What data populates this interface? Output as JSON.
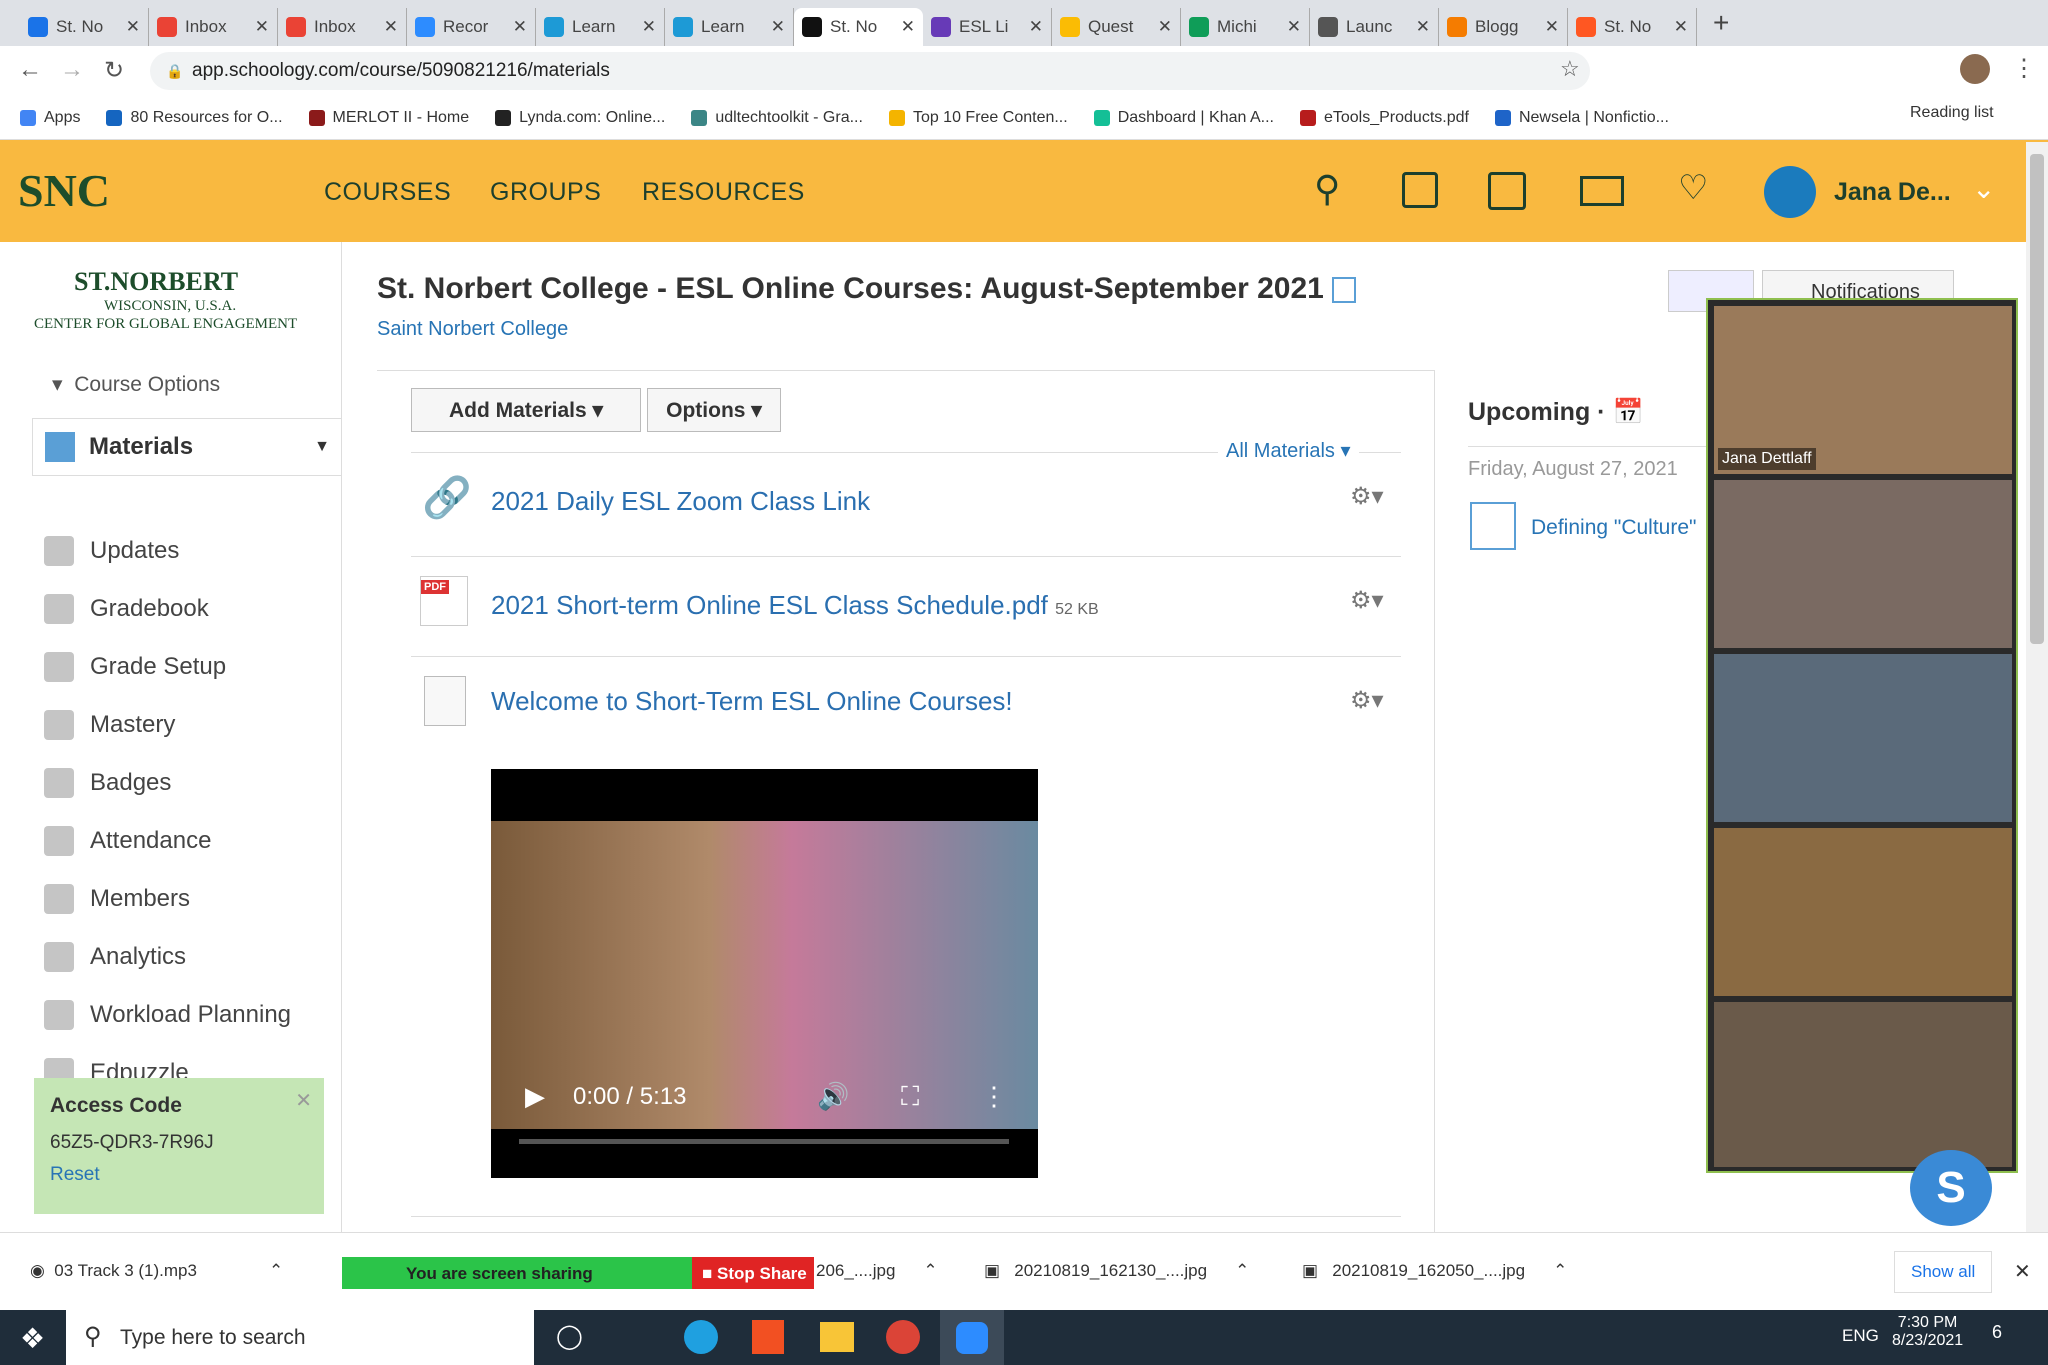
{
  "browser": {
    "tabs": [
      {
        "label": "St. No",
        "color": "#1a73e8"
      },
      {
        "label": "Inbox",
        "color": "#ea4335"
      },
      {
        "label": "Inbox",
        "color": "#ea4335"
      },
      {
        "label": "Recor",
        "color": "#2d8cff"
      },
      {
        "label": "Learn",
        "color": "#1d9ad6"
      },
      {
        "label": "Learn",
        "color": "#1d9ad6"
      },
      {
        "label": "St. No",
        "color": "#111111"
      },
      {
        "label": "ESL Li",
        "color": "#673ab7"
      },
      {
        "label": "Quest",
        "color": "#fbbc04"
      },
      {
        "label": "Michi",
        "color": "#0f9d58"
      },
      {
        "label": "Launc",
        "color": "#555555"
      },
      {
        "label": "Blogg",
        "color": "#f57c00"
      },
      {
        "label": "St. No",
        "color": "#ff5722"
      }
    ],
    "url": "app.schoology.com/course/5090821216/materials",
    "bookmarks": [
      {
        "label": "Apps",
        "color": "#4285f4"
      },
      {
        "label": "80 Resources for O...",
        "color": "#1565c0"
      },
      {
        "label": "MERLOT II - Home",
        "color": "#8b1a1a"
      },
      {
        "label": "Lynda.com: Online...",
        "color": "#222222"
      },
      {
        "label": "udltechtoolkit - Gra...",
        "color": "#3b8686"
      },
      {
        "label": "Top 10 Free Conten...",
        "color": "#f4b400"
      },
      {
        "label": "Dashboard | Khan A...",
        "color": "#14bf96"
      },
      {
        "label": "eTools_Products.pdf",
        "color": "#b71c1c"
      },
      {
        "label": "Newsela | Nonfictio...",
        "color": "#1e64c8"
      }
    ],
    "reading_list": "Reading list"
  },
  "header": {
    "logo": "SNC",
    "nav": [
      "COURSES",
      "GROUPS",
      "RESOURCES"
    ],
    "user": "Jana De...",
    "accent": "#f9b940"
  },
  "sidebar": {
    "school_logo": "ST. NORBERT WISCONSIN, U.S.A. CENTER FOR GLOBAL ENGAGEMENT",
    "course_options": "Course Options",
    "active": "Materials",
    "items": [
      "Updates",
      "Gradebook",
      "Grade Setup",
      "Mastery",
      "Badges",
      "Attendance",
      "Members",
      "Analytics",
      "Workload Planning",
      "Edpuzzle"
    ],
    "access": {
      "title": "Access Code",
      "code": "65Z5-QDR3-7R96J",
      "reset": "Reset"
    }
  },
  "course": {
    "title": "St. Norbert College - ESL Online Courses: August-September 2021",
    "subtitle": "Saint Norbert College",
    "notifications": "Notifications"
  },
  "toolbar": {
    "add": "Add Materials",
    "options": "Options",
    "filter": "All Materials"
  },
  "materials": [
    {
      "title": "2021 Daily ESL Zoom Class Link",
      "icon": "link-icon"
    },
    {
      "title": "2021 Short-term Online ESL Class Schedule.pdf",
      "size": "52 KB",
      "icon": "pdf-icon"
    },
    {
      "title": "Welcome to Short-Term ESL Online Courses!",
      "icon": "page-icon"
    }
  ],
  "video": {
    "time": "0:00 / 5:13"
  },
  "upcoming": {
    "title": "Upcoming ·",
    "date": "Friday, August 27, 2021",
    "event": "Defining \"Culture\""
  },
  "zoom": {
    "speaker": "Jana Dettlaff"
  },
  "downloads": {
    "items": [
      "03 Track 3 (1).mp3",
      "206_....jpg",
      "20210819_162130_....jpg",
      "20210819_162050_....jpg"
    ],
    "sharing": "You are screen sharing",
    "stop": "Stop Share",
    "show_all": "Show all"
  },
  "taskbar": {
    "search": "Type here to search",
    "lang": "ENG",
    "time": "7:30 PM",
    "date": "8/23/2021",
    "notif": "6"
  }
}
